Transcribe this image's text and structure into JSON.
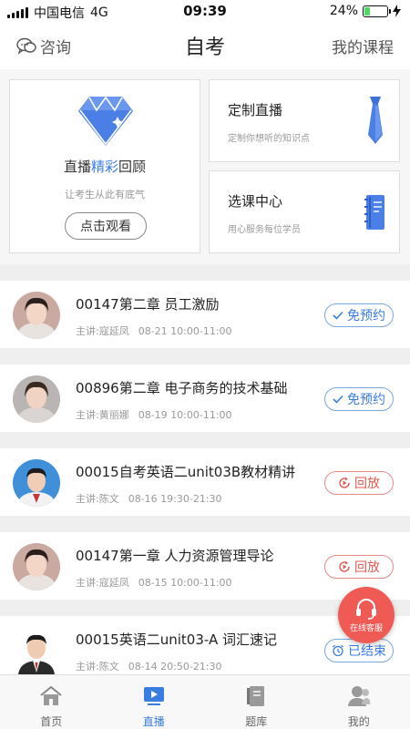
{
  "status_bar": {
    "carrier": "中国电信",
    "network": "4G",
    "time": "09:39",
    "battery": "24%",
    "battery_level": 0.24
  },
  "header": {
    "consult": "咨询",
    "title": "自考",
    "my_courses": "我的课程"
  },
  "feature_card": {
    "title_prefix": "直播",
    "title_highlight": "精彩",
    "title_suffix": "回顾",
    "subtitle": "让考生从此有底气",
    "button": "点击观看"
  },
  "side_cards": [
    {
      "title": "定制直播",
      "subtitle": "定制你想听的知识点",
      "icon": "tie-icon"
    },
    {
      "title": "选课中心",
      "subtitle": "用心服务每位学员",
      "icon": "notebook-icon"
    }
  ],
  "courses": [
    {
      "title": "00147第二章 员工激励",
      "teacher": "主讲:寇延凤",
      "time": "08-21 10:00-11:00",
      "status": "免预约",
      "status_type": "free",
      "avatar": "female-teacher-1"
    },
    {
      "title": "00896第二章 电子商务的技术基础",
      "teacher": "主讲:黄丽娜",
      "time": "08-19 10:00-11:00",
      "status": "免预约",
      "status_type": "free",
      "avatar": "female-teacher-2"
    },
    {
      "title": "00015自考英语二unit03B教材精讲",
      "teacher": "主讲:陈文",
      "time": "08-16 19:30-21:30",
      "status": "回放",
      "status_type": "replay",
      "avatar": "male-teacher-1"
    },
    {
      "title": "00147第一章 人力资源管理导论",
      "teacher": "主讲:寇延凤",
      "time": "08-15 10:00-11:00",
      "status": "回放",
      "status_type": "replay",
      "avatar": "female-teacher-1"
    },
    {
      "title": "00015英语二unit03-A 词汇速记",
      "teacher": "主讲:陈文",
      "time": "08-14 20:50-21:30",
      "status": "已结束",
      "status_type": "ended",
      "avatar": "male-teacher-2"
    }
  ],
  "fab": {
    "label": "在线客服"
  },
  "tabbar": [
    {
      "label": "首页",
      "icon": "home-icon",
      "active": false
    },
    {
      "label": "直播",
      "icon": "live-icon",
      "active": true
    },
    {
      "label": "题库",
      "icon": "question-bank-icon",
      "active": false
    },
    {
      "label": "我的",
      "icon": "profile-icon",
      "active": false
    }
  ],
  "colors": {
    "accent": "#3a7de0",
    "replay": "#e05a52",
    "fab": "#ef5a55",
    "background": "#f6f6f6"
  }
}
